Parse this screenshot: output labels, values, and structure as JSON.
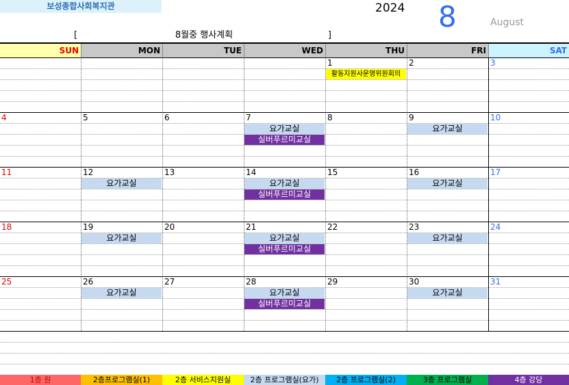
{
  "org_name": "보성종합사회복지관",
  "year": "2024",
  "month_number": "8",
  "month_name": "August",
  "subtitle": "8월중 행사계획",
  "bracket_left": "[",
  "bracket_right": "]",
  "days": [
    {
      "label": "SUN",
      "color": "#e00000",
      "bg": "#ffffaa"
    },
    {
      "label": "MON",
      "color": "#000000",
      "bg": "#c8c8c8"
    },
    {
      "label": "TUE",
      "color": "#000000",
      "bg": "#c8c8c8"
    },
    {
      "label": "WED",
      "color": "#000000",
      "bg": "#c8c8c8"
    },
    {
      "label": "THU",
      "color": "#000000",
      "bg": "#c8c8c8"
    },
    {
      "label": "FRI",
      "color": "#000000",
      "bg": "#c8c8c8"
    },
    {
      "label": "SAT",
      "color": "#2f6fef",
      "bg": "#cdf3ff"
    }
  ],
  "weeks": [
    {
      "days": [
        "",
        "",
        "",
        "",
        "1",
        "2",
        "3"
      ]
    },
    {
      "days": [
        "4",
        "5",
        "6",
        "7",
        "8",
        "9",
        "10"
      ]
    },
    {
      "days": [
        "11",
        "12",
        "13",
        "14",
        "15",
        "16",
        "17"
      ]
    },
    {
      "days": [
        "18",
        "19",
        "20",
        "21",
        "22",
        "23",
        "24"
      ]
    },
    {
      "days": [
        "25",
        "26",
        "27",
        "28",
        "29",
        "30",
        "31"
      ]
    }
  ],
  "events": [
    {
      "week": 0,
      "col": 4,
      "slot": 0,
      "text": "활동지원사운영위원회의",
      "bg": "#ffff00",
      "color": "#000000"
    },
    {
      "week": 1,
      "col": 3,
      "slot": 0,
      "text": "요가교실",
      "bg": "#c5d9f1",
      "color": "#000000"
    },
    {
      "week": 1,
      "col": 3,
      "slot": 1,
      "text": "실버푸르미교실",
      "bg": "#7030a0",
      "color": "#ffffff"
    },
    {
      "week": 1,
      "col": 5,
      "slot": 0,
      "text": "요가교실",
      "bg": "#c5d9f1",
      "color": "#000000"
    },
    {
      "week": 2,
      "col": 1,
      "slot": 0,
      "text": "요가교실",
      "bg": "#c5d9f1",
      "color": "#000000"
    },
    {
      "week": 2,
      "col": 3,
      "slot": 0,
      "text": "요가교실",
      "bg": "#c5d9f1",
      "color": "#000000"
    },
    {
      "week": 2,
      "col": 3,
      "slot": 1,
      "text": "실버푸르미교실",
      "bg": "#7030a0",
      "color": "#ffffff"
    },
    {
      "week": 2,
      "col": 5,
      "slot": 0,
      "text": "요가교실",
      "bg": "#c5d9f1",
      "color": "#000000"
    },
    {
      "week": 3,
      "col": 1,
      "slot": 0,
      "text": "요가교실",
      "bg": "#c5d9f1",
      "color": "#000000"
    },
    {
      "week": 3,
      "col": 3,
      "slot": 0,
      "text": "요가교실",
      "bg": "#c5d9f1",
      "color": "#000000"
    },
    {
      "week": 3,
      "col": 3,
      "slot": 1,
      "text": "실버푸르미교실",
      "bg": "#7030a0",
      "color": "#ffffff"
    },
    {
      "week": 3,
      "col": 5,
      "slot": 0,
      "text": "요가교실",
      "bg": "#c5d9f1",
      "color": "#000000"
    },
    {
      "week": 4,
      "col": 1,
      "slot": 0,
      "text": "요가교실",
      "bg": "#c5d9f1",
      "color": "#000000"
    },
    {
      "week": 4,
      "col": 3,
      "slot": 0,
      "text": "요가교실",
      "bg": "#c5d9f1",
      "color": "#000000"
    },
    {
      "week": 4,
      "col": 3,
      "slot": 1,
      "text": "실버푸르미교실",
      "bg": "#7030a0",
      "color": "#ffffff"
    },
    {
      "week": 4,
      "col": 5,
      "slot": 0,
      "text": "요가교실",
      "bg": "#c5d9f1",
      "color": "#000000"
    }
  ],
  "legend": [
    {
      "text": "1층 원",
      "bg": "#ff6666",
      "color": "#c00000"
    },
    {
      "text": "2층프로그램실(1)",
      "bg": "#ffc000",
      "color": "#000000"
    },
    {
      "text": "2층 서비스지원실",
      "bg": "#ffff00",
      "color": "#000000"
    },
    {
      "text": "2층 프로그램실(요가)",
      "bg": "#c5d9f1",
      "color": "#000000"
    },
    {
      "text": "2층 프로그램실(2)",
      "bg": "#00b0f0",
      "color": "#000000"
    },
    {
      "text": "3층 프로그램실",
      "bg": "#00b050",
      "color": "#000000"
    },
    {
      "text": "4층 강당",
      "bg": "#7030a0",
      "color": "#ffffff"
    }
  ]
}
